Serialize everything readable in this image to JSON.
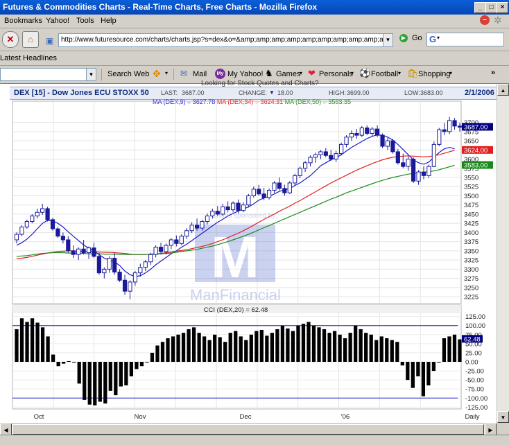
{
  "window": {
    "title": "Futures & Commodities Charts - Real-Time Charts, Free Charts - Mozilla Firefox"
  },
  "menu": [
    "Bookmarks",
    "Yahoo!",
    "Tools",
    "Help"
  ],
  "nav": {
    "url": "http://www.futuresource.com/charts/charts.jsp?s=dex&o=&amp;amp;amp;amp;amp;amp;amp;amp;amp;a=D",
    "go_label": "Go",
    "search_glyph": "G"
  },
  "bookmarks": {
    "latest_headlines": "Latest Headlines"
  },
  "yahoo_toolbar": {
    "search_web": "Search Web",
    "mail": "Mail",
    "my_yahoo": "My Yahoo!",
    "games": "Games",
    "personals": "Personals",
    "football": "Football",
    "shopping": "Shopping",
    "my_icon": "My"
  },
  "top_link": "Looking for Stock Quotes and Charts?",
  "quote": {
    "symbol": "DEX [15] - Dow Jones ECU STOXX 50",
    "last_label": "LAST:",
    "last": "3687.00",
    "change_label": "CHANGE:",
    "change": "18.00",
    "high_label": "HIGH:",
    "high": "3699.00",
    "low_label": "LOW:",
    "low": "3683.00",
    "date": "2/1/2006"
  },
  "ma_line": {
    "ma9": "MA (DEX,9) = 3627.78",
    "ma34": "MA (DEX,34) = 3624.31",
    "ma50": "MA (DEX,50) = 3583.35"
  },
  "watermark": {
    "sponsor": "Charts sponsored by:",
    "company": "ManFinancial",
    "logo_letter": "M"
  },
  "cci_title": "CCI (DEX,20) = 62.48",
  "colors": {
    "ma9": "#1a1acc",
    "ma34": "#e02020",
    "ma50": "#1a8a1a",
    "candle": "#1a1a99",
    "cci_line": "#1a1acc",
    "price_badge": "#000080",
    "ma34_badge": "#e02020",
    "ma50_badge": "#1a8a1a"
  },
  "chart_data": [
    {
      "type": "candlestick",
      "title": "DEX [15] - Dow Jones ECU STOXX 50",
      "xlabel": "",
      "ylabel": "",
      "ylim": [
        3210,
        3720
      ],
      "yticks": [
        3225,
        3250,
        3275,
        3300,
        3325,
        3350,
        3375,
        3400,
        3425,
        3450,
        3475,
        3500,
        3525,
        3550,
        3575,
        3600,
        3625,
        3650,
        3675,
        3700
      ],
      "x_tick_labels": [
        "Oct",
        "Nov",
        "Dec",
        "'06",
        "Daily"
      ],
      "last_value": "3687.00",
      "candles": [
        {
          "o": 3380,
          "h": 3400,
          "l": 3370,
          "c": 3395
        },
        {
          "o": 3395,
          "h": 3420,
          "l": 3390,
          "c": 3415
        },
        {
          "o": 3415,
          "h": 3435,
          "l": 3410,
          "c": 3430
        },
        {
          "o": 3430,
          "h": 3450,
          "l": 3425,
          "c": 3445
        },
        {
          "o": 3445,
          "h": 3465,
          "l": 3438,
          "c": 3455
        },
        {
          "o": 3455,
          "h": 3478,
          "l": 3448,
          "c": 3465
        },
        {
          "o": 3465,
          "h": 3470,
          "l": 3430,
          "c": 3435
        },
        {
          "o": 3435,
          "h": 3440,
          "l": 3405,
          "c": 3410
        },
        {
          "o": 3410,
          "h": 3415,
          "l": 3385,
          "c": 3390
        },
        {
          "o": 3390,
          "h": 3400,
          "l": 3370,
          "c": 3380
        },
        {
          "o": 3380,
          "h": 3390,
          "l": 3345,
          "c": 3350
        },
        {
          "o": 3350,
          "h": 3365,
          "l": 3330,
          "c": 3340
        },
        {
          "o": 3340,
          "h": 3360,
          "l": 3325,
          "c": 3355
        },
        {
          "o": 3355,
          "h": 3380,
          "l": 3340,
          "c": 3345
        },
        {
          "o": 3345,
          "h": 3362,
          "l": 3328,
          "c": 3358
        },
        {
          "o": 3358,
          "h": 3372,
          "l": 3330,
          "c": 3335
        },
        {
          "o": 3335,
          "h": 3345,
          "l": 3285,
          "c": 3290
        },
        {
          "o": 3290,
          "h": 3305,
          "l": 3275,
          "c": 3300
        },
        {
          "o": 3300,
          "h": 3335,
          "l": 3290,
          "c": 3330
        },
        {
          "o": 3330,
          "h": 3345,
          "l": 3285,
          "c": 3292
        },
        {
          "o": 3292,
          "h": 3300,
          "l": 3265,
          "c": 3270
        },
        {
          "o": 3270,
          "h": 3285,
          "l": 3230,
          "c": 3240
        },
        {
          "o": 3240,
          "h": 3270,
          "l": 3218,
          "c": 3265
        },
        {
          "o": 3265,
          "h": 3295,
          "l": 3255,
          "c": 3290
        },
        {
          "o": 3290,
          "h": 3315,
          "l": 3280,
          "c": 3305
        },
        {
          "o": 3305,
          "h": 3325,
          "l": 3295,
          "c": 3320
        },
        {
          "o": 3320,
          "h": 3345,
          "l": 3312,
          "c": 3340
        },
        {
          "o": 3340,
          "h": 3365,
          "l": 3332,
          "c": 3360
        },
        {
          "o": 3360,
          "h": 3372,
          "l": 3340,
          "c": 3348
        },
        {
          "o": 3348,
          "h": 3370,
          "l": 3340,
          "c": 3365
        },
        {
          "o": 3365,
          "h": 3385,
          "l": 3355,
          "c": 3380
        },
        {
          "o": 3380,
          "h": 3392,
          "l": 3362,
          "c": 3370
        },
        {
          "o": 3370,
          "h": 3395,
          "l": 3365,
          "c": 3390
        },
        {
          "o": 3390,
          "h": 3412,
          "l": 3382,
          "c": 3405
        },
        {
          "o": 3405,
          "h": 3428,
          "l": 3398,
          "c": 3420
        },
        {
          "o": 3420,
          "h": 3438,
          "l": 3405,
          "c": 3412
        },
        {
          "o": 3412,
          "h": 3435,
          "l": 3405,
          "c": 3430
        },
        {
          "o": 3430,
          "h": 3452,
          "l": 3422,
          "c": 3445
        },
        {
          "o": 3445,
          "h": 3465,
          "l": 3438,
          "c": 3458
        },
        {
          "o": 3458,
          "h": 3472,
          "l": 3445,
          "c": 3450
        },
        {
          "o": 3450,
          "h": 3478,
          "l": 3445,
          "c": 3470
        },
        {
          "o": 3470,
          "h": 3485,
          "l": 3455,
          "c": 3462
        },
        {
          "o": 3462,
          "h": 3485,
          "l": 3455,
          "c": 3480
        },
        {
          "o": 3480,
          "h": 3490,
          "l": 3452,
          "c": 3460
        },
        {
          "o": 3460,
          "h": 3482,
          "l": 3455,
          "c": 3475
        },
        {
          "o": 3475,
          "h": 3505,
          "l": 3468,
          "c": 3500
        },
        {
          "o": 3500,
          "h": 3525,
          "l": 3495,
          "c": 3518
        },
        {
          "o": 3518,
          "h": 3530,
          "l": 3500,
          "c": 3505
        },
        {
          "o": 3505,
          "h": 3522,
          "l": 3488,
          "c": 3495
        },
        {
          "o": 3495,
          "h": 3520,
          "l": 3490,
          "c": 3515
        },
        {
          "o": 3515,
          "h": 3540,
          "l": 3508,
          "c": 3535
        },
        {
          "o": 3535,
          "h": 3550,
          "l": 3515,
          "c": 3520
        },
        {
          "o": 3520,
          "h": 3530,
          "l": 3500,
          "c": 3508
        },
        {
          "o": 3508,
          "h": 3540,
          "l": 3505,
          "c": 3535
        },
        {
          "o": 3535,
          "h": 3560,
          "l": 3528,
          "c": 3555
        },
        {
          "o": 3555,
          "h": 3580,
          "l": 3548,
          "c": 3575
        },
        {
          "o": 3575,
          "h": 3595,
          "l": 3565,
          "c": 3590
        },
        {
          "o": 3590,
          "h": 3610,
          "l": 3580,
          "c": 3605
        },
        {
          "o": 3605,
          "h": 3618,
          "l": 3590,
          "c": 3612
        },
        {
          "o": 3612,
          "h": 3625,
          "l": 3600,
          "c": 3620
        },
        {
          "o": 3620,
          "h": 3630,
          "l": 3605,
          "c": 3610
        },
        {
          "o": 3610,
          "h": 3625,
          "l": 3595,
          "c": 3600
        },
        {
          "o": 3600,
          "h": 3622,
          "l": 3592,
          "c": 3615
        },
        {
          "o": 3615,
          "h": 3645,
          "l": 3610,
          "c": 3640
        },
        {
          "o": 3640,
          "h": 3665,
          "l": 3632,
          "c": 3660
        },
        {
          "o": 3660,
          "h": 3678,
          "l": 3650,
          "c": 3670
        },
        {
          "o": 3670,
          "h": 3682,
          "l": 3655,
          "c": 3665
        },
        {
          "o": 3665,
          "h": 3690,
          "l": 3660,
          "c": 3685
        },
        {
          "o": 3685,
          "h": 3692,
          "l": 3665,
          "c": 3670
        },
        {
          "o": 3670,
          "h": 3688,
          "l": 3662,
          "c": 3682
        },
        {
          "o": 3682,
          "h": 3692,
          "l": 3660,
          "c": 3665
        },
        {
          "o": 3665,
          "h": 3670,
          "l": 3630,
          "c": 3635
        },
        {
          "o": 3635,
          "h": 3658,
          "l": 3625,
          "c": 3650
        },
        {
          "o": 3650,
          "h": 3655,
          "l": 3615,
          "c": 3620
        },
        {
          "o": 3620,
          "h": 3628,
          "l": 3585,
          "c": 3590
        },
        {
          "o": 3590,
          "h": 3615,
          "l": 3575,
          "c": 3580
        },
        {
          "o": 3580,
          "h": 3608,
          "l": 3568,
          "c": 3600
        },
        {
          "o": 3600,
          "h": 3605,
          "l": 3535,
          "c": 3540
        },
        {
          "o": 3540,
          "h": 3570,
          "l": 3530,
          "c": 3565
        },
        {
          "o": 3565,
          "h": 3580,
          "l": 3545,
          "c": 3555
        },
        {
          "o": 3555,
          "h": 3585,
          "l": 3548,
          "c": 3580
        },
        {
          "o": 3580,
          "h": 3648,
          "l": 3578,
          "c": 3640
        },
        {
          "o": 3640,
          "h": 3685,
          "l": 3635,
          "c": 3680
        },
        {
          "o": 3680,
          "h": 3698,
          "l": 3665,
          "c": 3675
        },
        {
          "o": 3675,
          "h": 3715,
          "l": 3668,
          "c": 3705
        },
        {
          "o": 3705,
          "h": 3712,
          "l": 3680,
          "c": 3690
        },
        {
          "o": 3690,
          "h": 3699,
          "l": 3675,
          "c": 3687
        }
      ],
      "series": [
        {
          "name": "MA (DEX,9)",
          "values": [
            3365,
            3372,
            3382,
            3395,
            3410,
            3425,
            3433,
            3432,
            3425,
            3415,
            3402,
            3390,
            3378,
            3366,
            3357,
            3350,
            3340,
            3330,
            3325,
            3320,
            3310,
            3295,
            3285,
            3280,
            3282,
            3290,
            3300,
            3312,
            3322,
            3332,
            3342,
            3350,
            3360,
            3368,
            3378,
            3388,
            3398,
            3408,
            3418,
            3428,
            3436,
            3445,
            3452,
            3458,
            3464,
            3470,
            3478,
            3488,
            3494,
            3498,
            3505,
            3512,
            3516,
            3520,
            3528,
            3535,
            3545,
            3555,
            3568,
            3582,
            3590,
            3598,
            3604,
            3612,
            3622,
            3632,
            3640,
            3648,
            3656,
            3662,
            3666,
            3665,
            3660,
            3652,
            3640,
            3626,
            3612,
            3598,
            3590,
            3586,
            3592,
            3605,
            3618,
            3628,
            3632,
            3628
          ]
        },
        {
          "name": "MA (DEX,34)",
          "values": [
            3328,
            3330,
            3332,
            3335,
            3338,
            3341,
            3344,
            3346,
            3348,
            3349,
            3350,
            3350,
            3349,
            3349,
            3348,
            3348,
            3347,
            3346,
            3346,
            3345,
            3344,
            3343,
            3341,
            3340,
            3340,
            3340,
            3341,
            3342,
            3343,
            3345,
            3347,
            3349,
            3351,
            3353,
            3356,
            3359,
            3362,
            3366,
            3370,
            3375,
            3380,
            3386,
            3392,
            3398,
            3405,
            3412,
            3420,
            3428,
            3436,
            3443,
            3450,
            3458,
            3465,
            3472,
            3480,
            3487,
            3495,
            3503,
            3511,
            3519,
            3527,
            3535,
            3542,
            3549,
            3556,
            3563,
            3570,
            3576,
            3582,
            3588,
            3593,
            3598,
            3602,
            3605,
            3607,
            3608,
            3609,
            3608,
            3607,
            3606,
            3607,
            3609,
            3612,
            3616,
            3620,
            3624
          ]
        },
        {
          "name": "MA (DEX,50)",
          "values": [
            3335,
            3336,
            3337,
            3339,
            3341,
            3343,
            3344,
            3345,
            3345,
            3345,
            3344,
            3344,
            3343,
            3343,
            3342,
            3342,
            3342,
            3341,
            3341,
            3341,
            3340,
            3340,
            3340,
            3340,
            3340,
            3340,
            3341,
            3341,
            3342,
            3343,
            3344,
            3346,
            3348,
            3350,
            3352,
            3354,
            3357,
            3360,
            3363,
            3367,
            3371,
            3375,
            3380,
            3385,
            3390,
            3395,
            3401,
            3407,
            3413,
            3419,
            3425,
            3431,
            3437,
            3443,
            3449,
            3455,
            3461,
            3467,
            3473,
            3479,
            3485,
            3491,
            3496,
            3502,
            3508,
            3513,
            3518,
            3523,
            3528,
            3533,
            3538,
            3542,
            3546,
            3550,
            3553,
            3556,
            3559,
            3561,
            3563,
            3564,
            3566,
            3568,
            3571,
            3575,
            3579,
            3583
          ]
        }
      ]
    },
    {
      "type": "bar",
      "title": "CCI (DEX,20) = 62.48",
      "xlabel": "",
      "ylabel": "",
      "ylim": [
        -130,
        130
      ],
      "yticks": [
        125,
        100,
        75,
        50,
        25,
        0,
        -25,
        -50,
        -75,
        -100,
        -125
      ],
      "ref_lines": [
        100,
        -100
      ],
      "last_value": "62.48",
      "series": [
        {
          "name": "CCI (DEX,20)",
          "values": [
            90,
            120,
            110,
            120,
            108,
            95,
            70,
            20,
            -12,
            -5,
            2,
            -2,
            -60,
            -105,
            -118,
            -120,
            -110,
            -115,
            -80,
            -92,
            -68,
            -65,
            -40,
            -20,
            -12,
            0,
            25,
            45,
            55,
            65,
            70,
            75,
            80,
            90,
            95,
            80,
            70,
            60,
            75,
            68,
            55,
            80,
            85,
            70,
            60,
            75,
            85,
            88,
            72,
            80,
            90,
            100,
            92,
            85,
            100,
            105,
            110,
            100,
            95,
            90,
            80,
            85,
            75,
            65,
            80,
            100,
            90,
            80,
            75,
            60,
            70,
            65,
            60,
            55,
            -10,
            -50,
            -72,
            -40,
            -95,
            -65,
            -25,
            0,
            65,
            70,
            75,
            62
          ]
        }
      ]
    }
  ]
}
